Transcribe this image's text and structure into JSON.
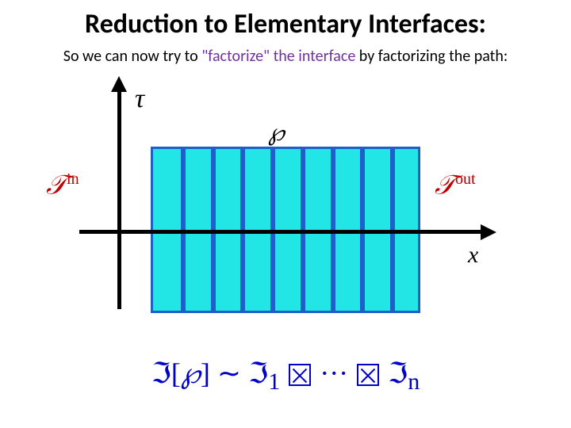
{
  "title": "Reduction to Elementary Interfaces:",
  "subtitle_pre": "So we can now try to ",
  "subtitle_mid": "\"factorize\" the interface ",
  "subtitle_post": "by factorizing the path:",
  "colors": {
    "subtitle_mid": "#7030a0",
    "accent_red": "#c00000",
    "formula_blue": "#0000cc",
    "cyan": "#22e6e6",
    "stripe": "#1f5fc9"
  },
  "labels": {
    "tau": "τ",
    "wp": "℘",
    "tin_base": "𝒯",
    "tin_sup": "in",
    "tout_base": "𝒯",
    "tout_sup": "out",
    "x": "x"
  },
  "formula": {
    "I": "ℑ",
    "wp": "℘",
    "sim": "∼",
    "sub1": "1",
    "dots": "···",
    "subn": "n"
  },
  "chart_data": {
    "type": "diagram",
    "stripes": 8,
    "axes": [
      "tau (vertical)",
      "x (horizontal)"
    ],
    "block": {
      "fill": "cyan",
      "border": "blue",
      "vertical_bars": 8
    },
    "annotations": [
      "T^in (left, red)",
      "T^out (right, red)",
      "wp (top, script)"
    ],
    "equation": "I[wp] ~ I_1 ⊠ ··· ⊠ I_n"
  }
}
